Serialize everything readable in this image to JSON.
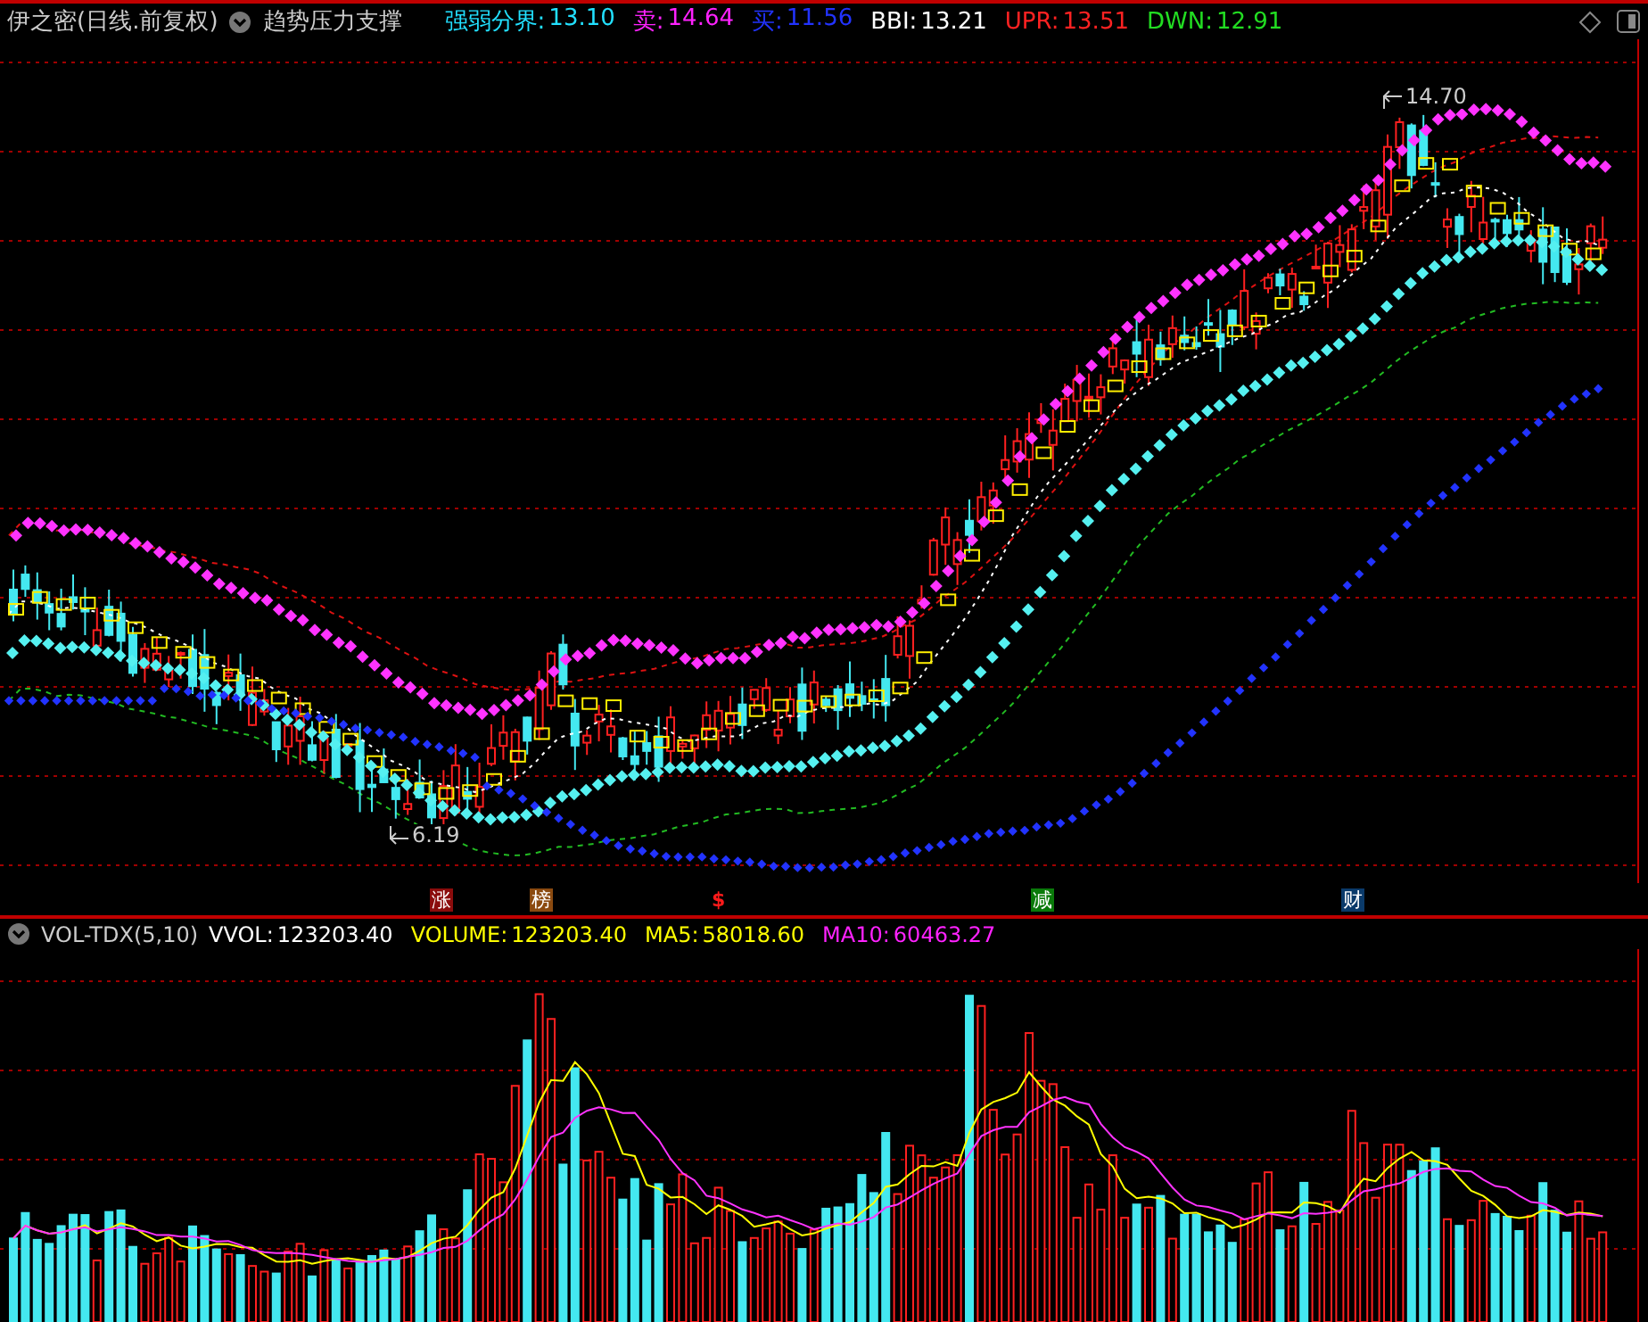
{
  "header": {
    "title": "伊之密(日线.前复权)",
    "indicator_name": "趋势压力支撑",
    "values": [
      {
        "label": "强弱分界:",
        "value": "13.10",
        "color": "#22e0ff"
      },
      {
        "label": "卖:",
        "value": "14.64",
        "color": "#ff22ff"
      },
      {
        "label": "买:",
        "value": "11.56",
        "color": "#2233ff"
      },
      {
        "label": "BBI:",
        "value": "13.21",
        "color": "#ffffff"
      },
      {
        "label": "UPR:",
        "value": "13.51",
        "color": "#ff2222"
      },
      {
        "label": "DWN:",
        "value": "12.91",
        "color": "#22dd22"
      }
    ]
  },
  "annotations": [
    {
      "text": "14.70"
    },
    {
      "text": "6.19"
    }
  ],
  "markers": [
    {
      "text": "涨",
      "kind": "badge",
      "color": "#8b0c0c"
    },
    {
      "text": "榜",
      "kind": "badge",
      "color": "#8b4a10"
    },
    {
      "text": "$",
      "kind": "symbol",
      "color": "#ff1a1a"
    },
    {
      "text": "减",
      "kind": "badge",
      "color": "#0a7a0a"
    },
    {
      "text": "财",
      "kind": "badge",
      "color": "#0a3a6a"
    }
  ],
  "volume_header": {
    "name": "VOL-TDX(5,10)",
    "values": [
      {
        "label": "VVOL:",
        "value": "123203.40",
        "color": "#ffffff"
      },
      {
        "label": "VOLUME:",
        "value": "123203.40",
        "color": "#ffff00"
      },
      {
        "label": "MA5:",
        "value": "58018.60",
        "color": "#ffff00"
      },
      {
        "label": "MA10:",
        "value": "60463.27",
        "color": "#ff22ff"
      }
    ]
  }
}
